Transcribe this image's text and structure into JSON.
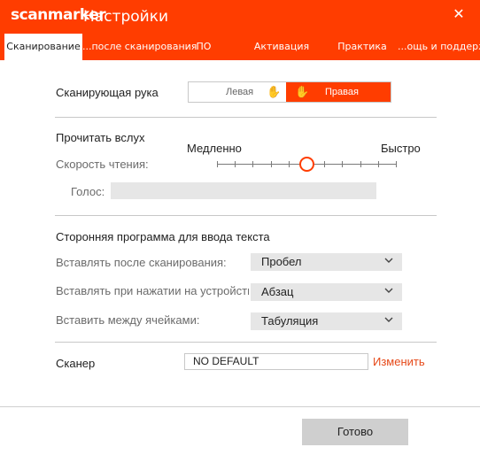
{
  "window": {
    "logo": "scanmarker",
    "title": "Настройки",
    "close_glyph": "✕"
  },
  "tabs": [
    {
      "label": "Сканирование",
      "active": true
    },
    {
      "label": "...после сканирования",
      "active": false
    },
    {
      "label": "ПО",
      "active": false
    },
    {
      "label": "Активация",
      "active": false
    },
    {
      "label": "Практика",
      "active": false
    },
    {
      "label": "...ощь и поддержка",
      "active": false
    }
  ],
  "hand": {
    "label": "Сканирующая рука",
    "left_label": "Левая",
    "right_label": "Правая",
    "selected": "right",
    "left_icon": "hand-icon",
    "right_icon": "hand-icon"
  },
  "read_aloud": {
    "heading": "Прочитать вслух",
    "slow_label": "Медленно",
    "fast_label": "Быстро",
    "speed_label": "Скорость чтения:",
    "speed_position": 0.5,
    "tick_count": 11,
    "voice_label": "Голос:",
    "voice_value": ""
  },
  "third_party": {
    "heading": "Сторонняя программа для ввода текста",
    "rows": [
      {
        "label": "Вставлять после сканирования:",
        "value": "Пробел"
      },
      {
        "label": "Вставлять при нажатии на устройстве",
        "value": "Абзац"
      },
      {
        "label": "Вставить между ячейками:",
        "value": "Табуляция"
      }
    ]
  },
  "scanner": {
    "label": "Сканер",
    "value": "NO DEFAULT",
    "change_label": "Изменить"
  },
  "footer": {
    "done_label": "Готово"
  },
  "colors": {
    "accent": "#ff3d00",
    "link": "#e64a1a"
  }
}
